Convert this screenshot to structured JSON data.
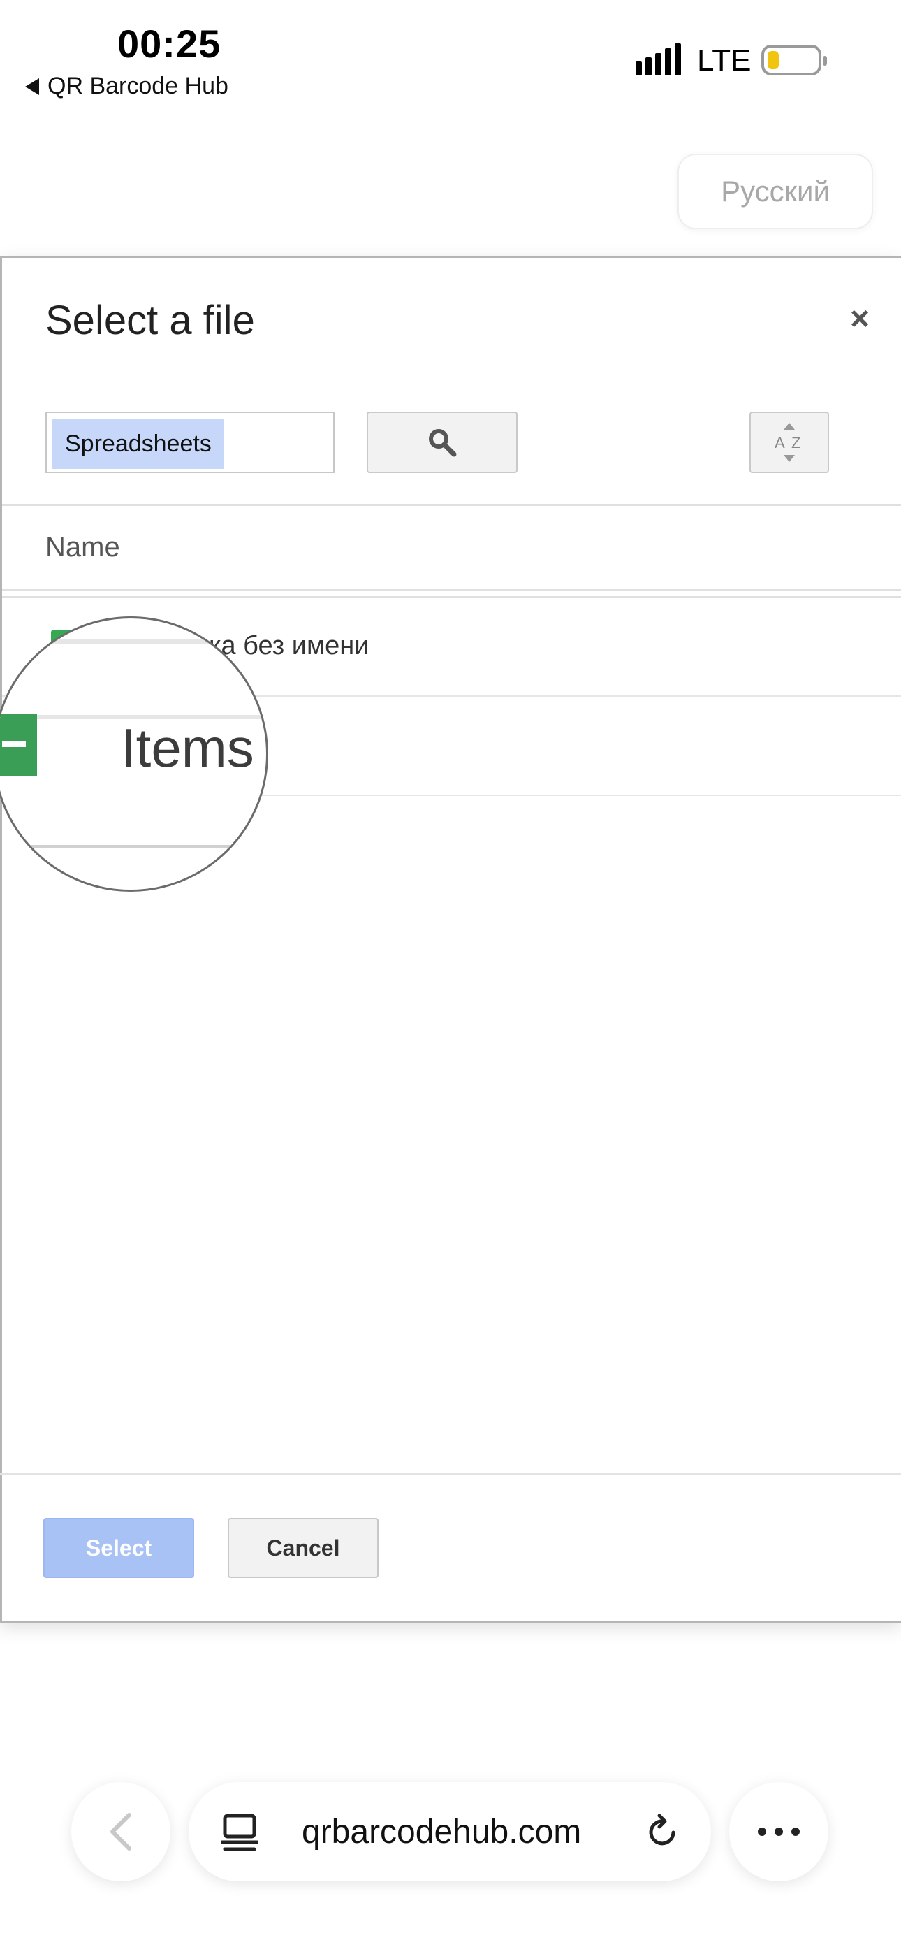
{
  "status_bar": {
    "time": "00:25",
    "back_app": "QR Barcode Hub",
    "network": "LTE"
  },
  "language": {
    "label": "Русский"
  },
  "dialog": {
    "title": "Select a file",
    "close": "×",
    "search_value": "Spreadsheets",
    "column_header": "Name",
    "rows": [
      {
        "label": "ка без имени"
      }
    ],
    "magnifier_text": "Items",
    "select_label": "Select",
    "cancel_label": "Cancel"
  },
  "browser": {
    "url": "qrbarcodehub.com"
  },
  "icons": {
    "search": "search-icon",
    "sort": "sort-az-icon",
    "sheet": "spreadsheet-icon",
    "tabs": "tabs-icon",
    "reload": "reload-icon",
    "more": "more-icon",
    "back": "chevron-left-icon"
  }
}
